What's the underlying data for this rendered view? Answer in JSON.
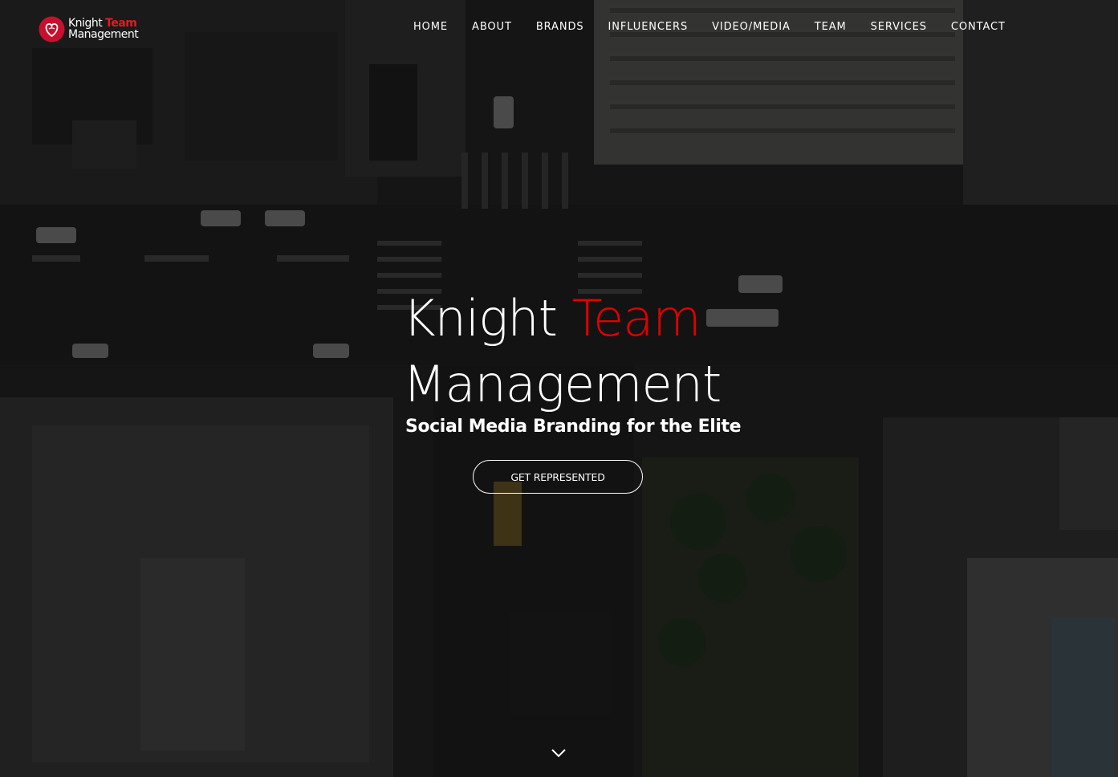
{
  "brand": {
    "logo_line1_a": "Knight",
    "logo_line1_b": "Team",
    "logo_line2": "Management",
    "accent_color": "#e31b23"
  },
  "nav": {
    "items": [
      {
        "label": "HOME"
      },
      {
        "label": "ABOUT"
      },
      {
        "label": "BRANDS"
      },
      {
        "label": "INFLUENCERS"
      },
      {
        "label": "VIDEO/MEDIA"
      },
      {
        "label": "TEAM"
      },
      {
        "label": "SERVICES"
      },
      {
        "label": "CONTACT"
      }
    ]
  },
  "hero": {
    "headline_word1": "Knight",
    "headline_word2": "Team",
    "headline_line2": "Management",
    "tagline": "Social Media Branding for the Elite",
    "cta_label": "GET REPRESENTED",
    "background": "aerial-city-intersection-photo",
    "scroll_icon": "chevron-down-icon"
  }
}
